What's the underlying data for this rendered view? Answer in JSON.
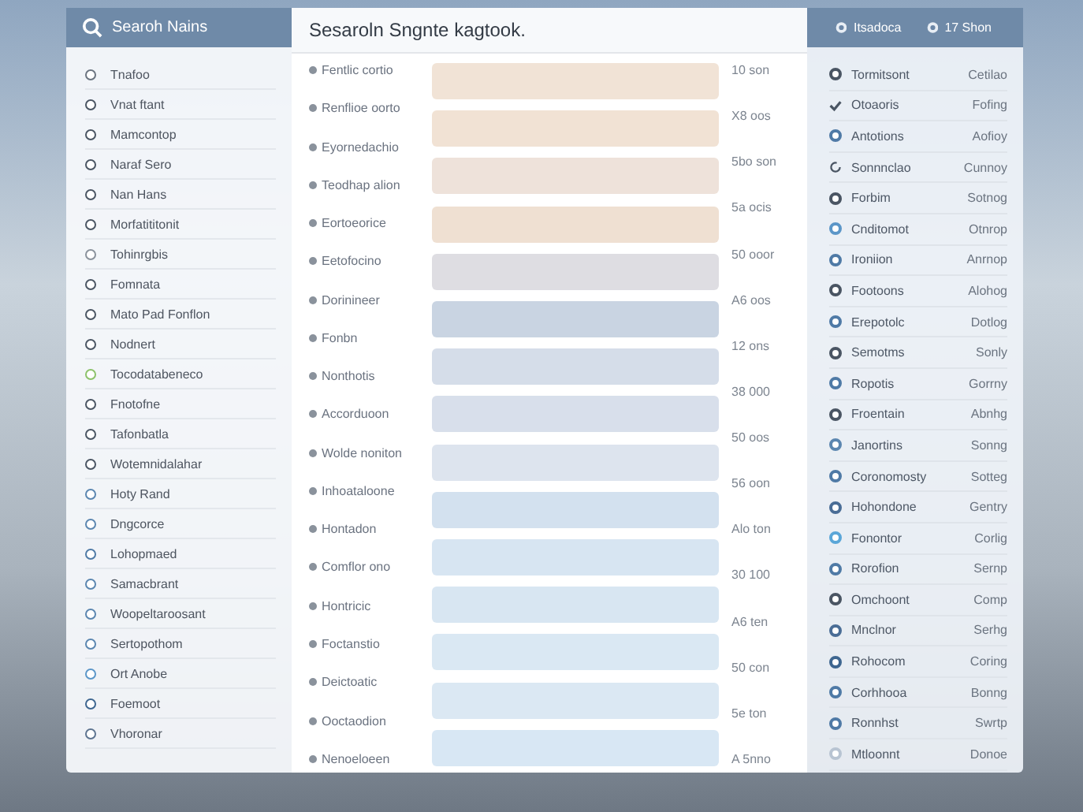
{
  "left_panel": {
    "title": "Searoh Nains",
    "items": [
      {
        "label": "Tnafoo",
        "color": "#6b7480"
      },
      {
        "label": "Vnat ftant",
        "color": "#4a5563"
      },
      {
        "label": "Mamcontop",
        "color": "#4a5563"
      },
      {
        "label": "Naraf Sero",
        "color": "#4a5563"
      },
      {
        "label": "Nan Hans",
        "color": "#4a5563"
      },
      {
        "label": "Morfatititonit",
        "color": "#4a5563"
      },
      {
        "label": "Tohinrgbis",
        "color": "#8a929c"
      },
      {
        "label": "Fomnata",
        "color": "#4a5563"
      },
      {
        "label": "Mato Pad Fonflon",
        "color": "#4a5563"
      },
      {
        "label": "Nodnert",
        "color": "#4a5563"
      },
      {
        "label": "Tocodatabeneco",
        "color": "#8cc26a"
      },
      {
        "label": "Fnotofne",
        "color": "#4a5563"
      },
      {
        "label": "Tafonbatla",
        "color": "#4a5563"
      },
      {
        "label": "Wotemnidalahar",
        "color": "#4a5563"
      },
      {
        "label": "Hoty Rand",
        "color": "#5b86b0"
      },
      {
        "label": "Dngcorce",
        "color": "#5b86b0"
      },
      {
        "label": "Lohopmaed",
        "color": "#4f7aa6"
      },
      {
        "label": "Samacbrant",
        "color": "#5b86b0"
      },
      {
        "label": "Woopeltaroosant",
        "color": "#5b86b0"
      },
      {
        "label": "Sertopothom",
        "color": "#5b86b0"
      },
      {
        "label": "Ort Anobe",
        "color": "#5b96c8"
      },
      {
        "label": "Foemoot",
        "color": "#3e6690"
      },
      {
        "label": "Vhoronar",
        "color": "#5e7490"
      }
    ]
  },
  "center_panel": {
    "title": "Sesaroln Sngnte kagtook.",
    "labels": [
      "Fentlic cortio",
      "Renflioe oorto",
      "Eyornedachio",
      "Teodhap alion",
      "Eortoeorice",
      "Eetofocino",
      "Dorinineer",
      "Fonbn",
      "Nonthotis",
      "Accorduoon",
      "Wolde noniton",
      "Inhoataloone",
      "Hontadon",
      "Comflor ono",
      "Hontricic",
      "Foctanstio",
      "Deictoatic",
      "Ooctaodion",
      "Nenoeloeen"
    ],
    "bars": [
      {
        "color": "#f1e3d6"
      },
      {
        "color": "#f1e2d4"
      },
      {
        "color": "#eee2da"
      },
      {
        "color": "#efe0d2"
      },
      {
        "color": "#dedde2"
      },
      {
        "color": "#c9d4e2"
      },
      {
        "color": "#d5dde9"
      },
      {
        "color": "#d8dfeb"
      },
      {
        "color": "#dde4ee"
      },
      {
        "color": "#d3e1ef"
      },
      {
        "color": "#d7e5f2"
      },
      {
        "color": "#d8e6f2"
      },
      {
        "color": "#dae8f3"
      },
      {
        "color": "#dbe8f3"
      },
      {
        "color": "#d8e7f4"
      }
    ],
    "values": [
      "10 son",
      "X8 oos",
      "5bo son",
      "5a ocis",
      "50 ooor",
      "A6 oos",
      "12 ons",
      "38 000",
      "50 oos",
      "56 oon",
      "Alo ton",
      "30 100",
      "A6 ten",
      "50 con",
      "5e ton",
      "A 5nno"
    ]
  },
  "right_panel": {
    "header_items": [
      "Itsadoca",
      "17 Shon"
    ],
    "items": [
      {
        "kind": "dot",
        "color": "#4a5563",
        "name": "Tormitsont",
        "value": "Cetilao"
      },
      {
        "kind": "check",
        "color": "#4a5563",
        "name": "Otoaoris",
        "value": "Fofing"
      },
      {
        "kind": "dot",
        "color": "#4f7aa6",
        "name": "Antotions",
        "value": "Aofioy"
      },
      {
        "kind": "refresh",
        "color": "#4a5563",
        "name": "Sonnnclao",
        "value": "Cunnoy"
      },
      {
        "kind": "dot",
        "color": "#4a5563",
        "name": "Forbim",
        "value": "Sotnog"
      },
      {
        "kind": "dot",
        "color": "#5b96c8",
        "name": "Cnditomot",
        "value": "Otnrop"
      },
      {
        "kind": "dot",
        "color": "#4f7aa6",
        "name": "Ironiion",
        "value": "Anrnop"
      },
      {
        "kind": "dot",
        "color": "#4a5563",
        "name": "Footoons",
        "value": "Alohog"
      },
      {
        "kind": "dot",
        "color": "#4f7aa6",
        "name": "Erepotolc",
        "value": "Dotlog"
      },
      {
        "kind": "dot",
        "color": "#4a5563",
        "name": "Semotms",
        "value": "Sonly"
      },
      {
        "kind": "dot",
        "color": "#4f7aa6",
        "name": "Ropotis",
        "value": "Gorrny"
      },
      {
        "kind": "dot",
        "color": "#4a5563",
        "name": "Froentain",
        "value": "Abnhg"
      },
      {
        "kind": "dot",
        "color": "#5b86b0",
        "name": "Janortins",
        "value": "Sonng"
      },
      {
        "kind": "dot",
        "color": "#4f7aa6",
        "name": "Coronomosty",
        "value": "Sotteg"
      },
      {
        "kind": "dot",
        "color": "#4a6d96",
        "name": "Hohondone",
        "value": "Gentry"
      },
      {
        "kind": "dot",
        "color": "#5aa6d8",
        "name": "Fonontor",
        "value": "Corlig"
      },
      {
        "kind": "dot",
        "color": "#4f7aa6",
        "name": "Rorofion",
        "value": "Sernp"
      },
      {
        "kind": "dot",
        "color": "#4a5563",
        "name": "Omchoont",
        "value": "Comp"
      },
      {
        "kind": "dot",
        "color": "#4a6d96",
        "name": "Mnclnor",
        "value": "Serhg"
      },
      {
        "kind": "dot",
        "color": "#3e6690",
        "name": "Rohocom",
        "value": "Coring"
      },
      {
        "kind": "dot",
        "color": "#4f7aa6",
        "name": "Corhhooa",
        "value": "Bonng"
      },
      {
        "kind": "dot",
        "color": "#4f7aa6",
        "name": "Ronnhst",
        "value": "Swrtp"
      },
      {
        "kind": "dot",
        "color": "#b8c4d2",
        "name": "Mtloonnt",
        "value": "Donoe"
      }
    ]
  }
}
